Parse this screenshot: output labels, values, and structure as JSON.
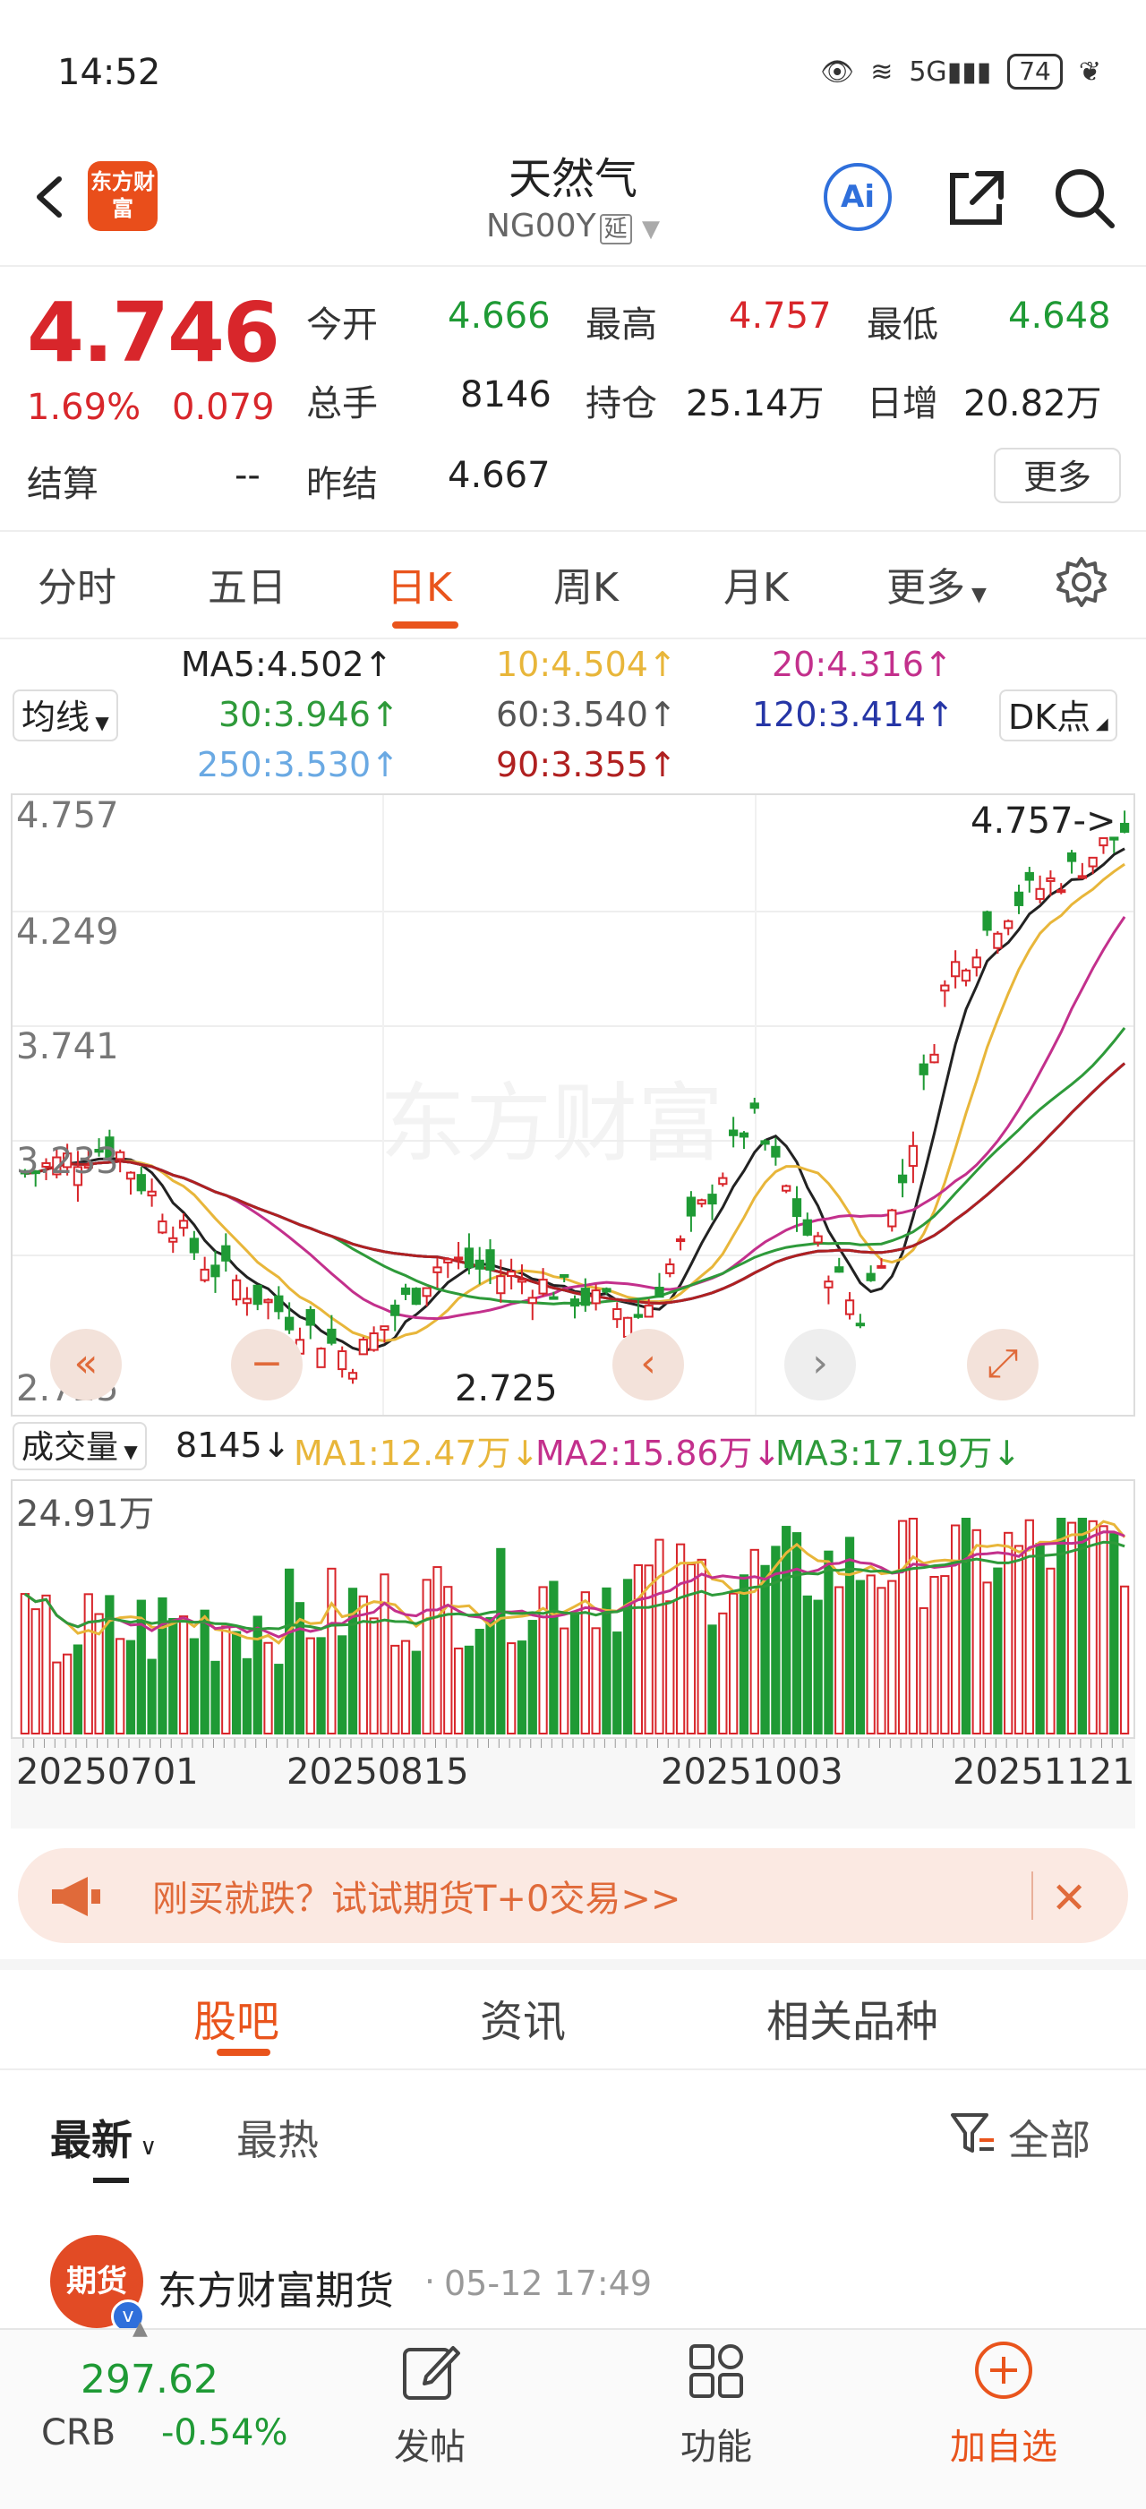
{
  "status_bar": {
    "time": "14:52",
    "network": "5G",
    "battery": "74"
  },
  "header": {
    "title": "天然气",
    "code": "NG00Y",
    "delay_tag": "延",
    "logo_text": "东方财富",
    "ai_label": "Ai"
  },
  "quote": {
    "price": "4.746",
    "change_pct": "1.69%",
    "change": "0.079",
    "open_label": "今开",
    "open": "4.666",
    "high_label": "最高",
    "high": "4.757",
    "low_label": "最低",
    "low": "4.648",
    "volume_label": "总手",
    "volume": "8146",
    "oi_label": "持仓",
    "oi": "25.14万",
    "daily_inc_label": "日增",
    "daily_inc": "20.82万",
    "settle_label": "结算",
    "settle": "--",
    "prev_settle_label": "昨结",
    "prev_settle": "4.667",
    "more_label": "更多"
  },
  "period_tabs": [
    "分时",
    "五日",
    "日K",
    "周K",
    "月K",
    "更多"
  ],
  "ma_legend": {
    "selector": "均线",
    "dk_label": "DK点",
    "items": [
      {
        "text": "MA5:4.502↑",
        "color": "#222222"
      },
      {
        "text": "10:4.504↑",
        "color": "#e8b63a"
      },
      {
        "text": "20:4.316↑",
        "color": "#c3308c"
      },
      {
        "text": "30:3.946↑",
        "color": "#2e9a3a"
      },
      {
        "text": "60:3.540↑",
        "color": "#555555"
      },
      {
        "text": "120:3.414↑",
        "color": "#2636a6"
      },
      {
        "text": "250:3.530↑",
        "color": "#6aa9e3"
      },
      {
        "text": "90:3.355↑",
        "color": "#b02020"
      }
    ]
  },
  "kline": {
    "y_labels": [
      "4.757",
      "4.249",
      "3.741",
      "3.233",
      "2.725"
    ],
    "max_label": "4.757->",
    "min_label": "2.725",
    "watermark": "东方财富"
  },
  "volume_panel": {
    "selector": "成交量",
    "value": "8145↓",
    "ma1": "MA1:12.47万↓",
    "ma2": "MA2:15.86万↓",
    "ma3": "MA3:17.19万↓",
    "y_label": "24.91万",
    "dates": [
      "20250701",
      "20250815",
      "20251003",
      "20251121"
    ]
  },
  "banner": {
    "text": "刚买就跌？试试期货T+0交易>>"
  },
  "section_tabs": [
    "股吧",
    "资讯",
    "相关品种"
  ],
  "feed_tabs": {
    "latest": "最新",
    "hot": "最热",
    "filter": "全部"
  },
  "post": {
    "avatar_text": "期货",
    "author": "东方财富期货",
    "time": "05-12 17:49"
  },
  "bottom_nav": {
    "crb_value": "297.62",
    "crb_label": "CRB",
    "crb_change": "-0.54%",
    "post_label": "发帖",
    "function_label": "功能",
    "add_label": "加自选"
  },
  "colors": {
    "up": "#d8262b",
    "down": "#1f9a35",
    "accent": "#e9541c"
  }
}
